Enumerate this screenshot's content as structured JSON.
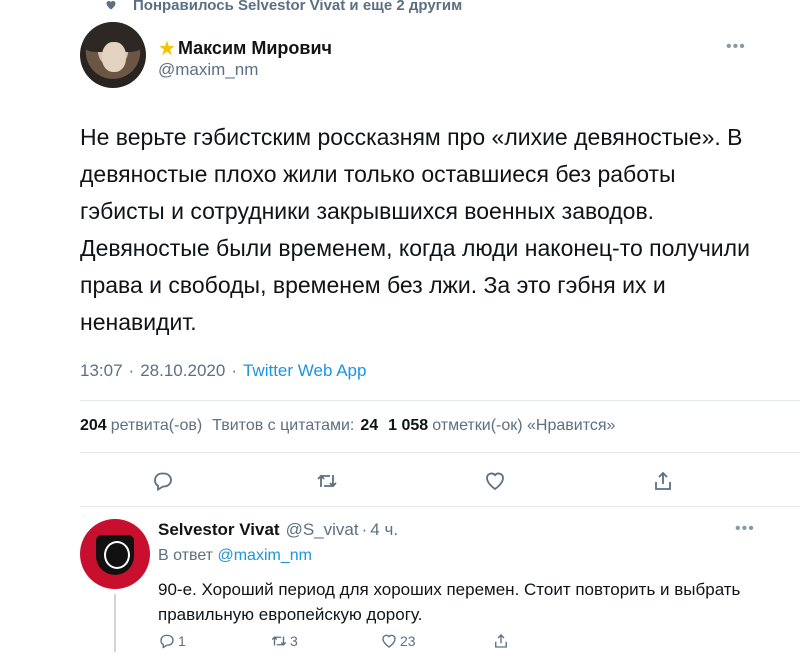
{
  "banner": {
    "text": "Понравилось Selvestor Vivat и еще 2 другим",
    "icon": "heart-icon"
  },
  "tweet": {
    "author_name": "Максим Мирович",
    "author_badge_icon": "star-icon",
    "author_handle": "@maxim_nm",
    "more_icon": "more-horizontal-icon",
    "text": "Не верьте гэбистским россказням про «лихие девяностые». В девяностые плохо жили только оставшиеся без работы гэбисты и сотрудники закрывшихся военных заводов. Девяностые были временем, когда люди наконец-то получили права и свободы, временем без лжи. За это гэбня их и ненавидит.",
    "time": "13:07",
    "date": "28.10.2020",
    "separator": "·",
    "source": "Twitter Web App",
    "stats": {
      "retweets_count": "204",
      "retweets_label": "ретвита(-ов)",
      "quotes_label": "Твитов с цитатами:",
      "quotes_count": "24",
      "likes_count": "1 058",
      "likes_label": "отметки(-ок) «Нравится»"
    },
    "actions": [
      "reply-icon",
      "retweet-icon",
      "like-icon",
      "share-icon"
    ]
  },
  "reply": {
    "author_name": "Selvestor Vivat",
    "author_handle": "@S_vivat",
    "separator": "·",
    "time": "4 ч.",
    "reply_prefix": "В ответ",
    "reply_mention": "@maxim_nm",
    "text": "90-е. Хороший период для хороших перемен. Стоит повторить и выбрать правильную европейскую дорогу.",
    "counts": {
      "replies": "1",
      "retweets": "3",
      "likes": "23"
    }
  },
  "colors": {
    "accent": "#1b95e0",
    "muted": "#5b7083",
    "divider": "#e1e8ed",
    "star": "#f2c400",
    "avatar_red": "#c8102e"
  }
}
